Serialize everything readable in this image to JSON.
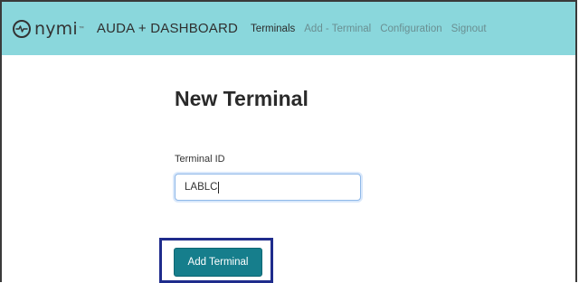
{
  "navbar": {
    "logo_text": "nymi",
    "logo_tm": "™",
    "app_title": "AUDA + DASHBOARD",
    "links": [
      {
        "label": "Terminals",
        "active": true
      },
      {
        "label": "Add - Terminal",
        "active": false
      },
      {
        "label": "Configuration",
        "active": false
      },
      {
        "label": "Signout",
        "active": false
      }
    ],
    "bg_color": "#8ad7dc"
  },
  "page": {
    "title": "New Terminal"
  },
  "form": {
    "terminal_id_label": "Terminal ID",
    "terminal_id_value": "LABLC",
    "submit_label": "Add Terminal"
  },
  "colors": {
    "button": "#167e8c",
    "highlight_border": "#1f2c8c"
  }
}
